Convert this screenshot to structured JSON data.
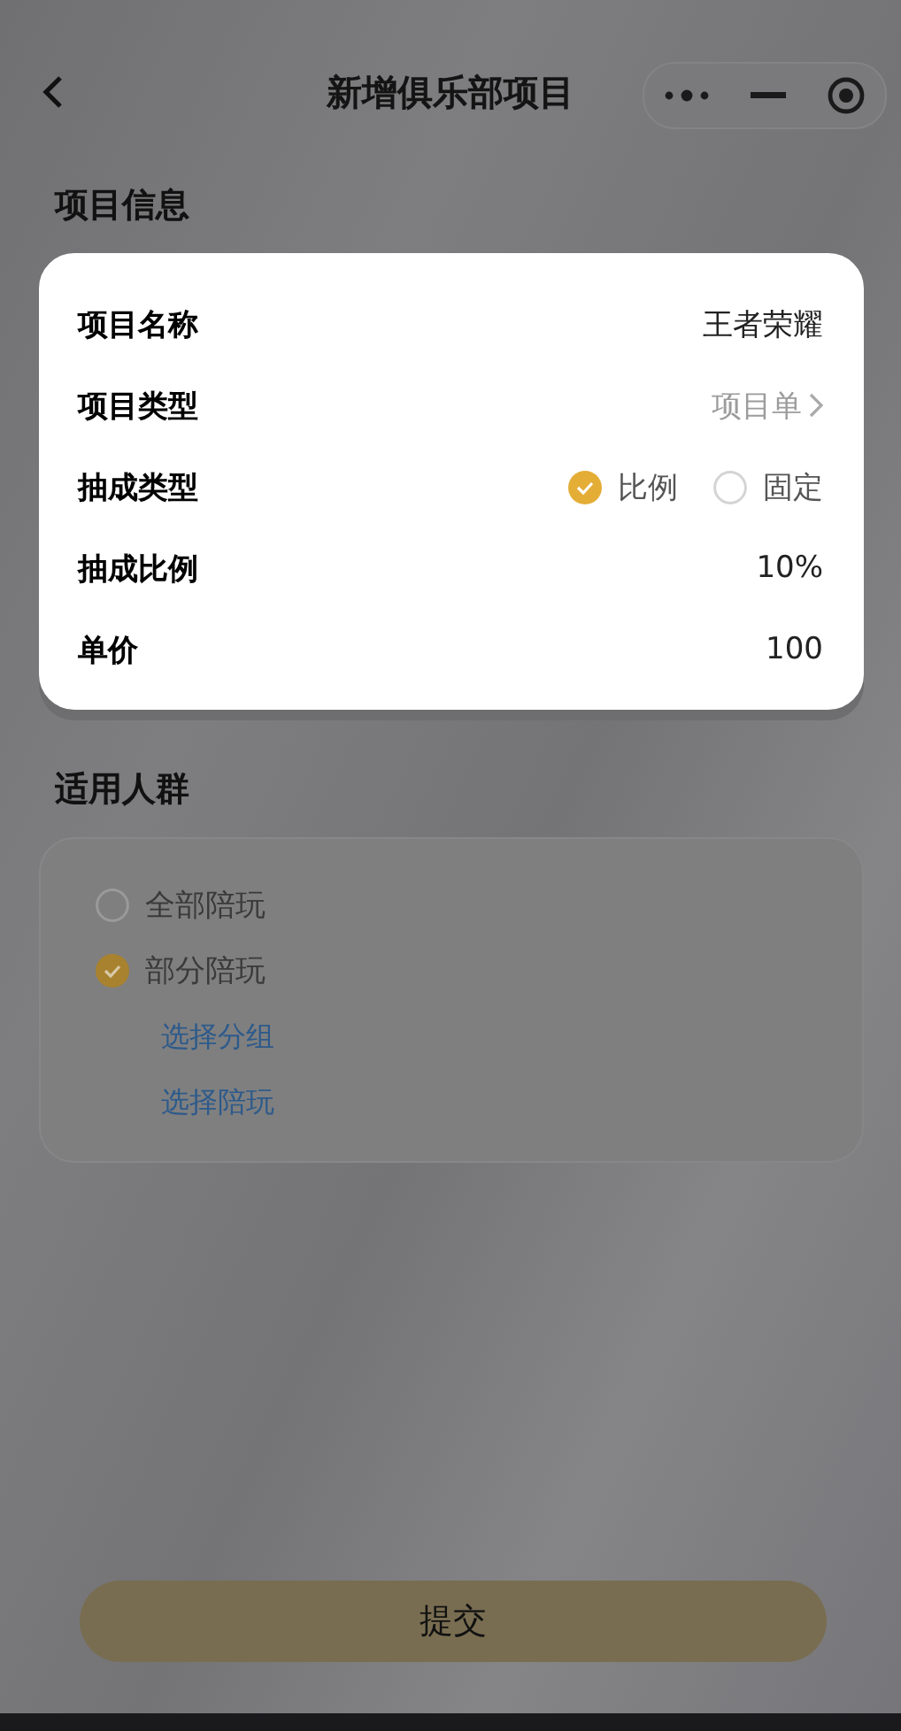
{
  "nav": {
    "title": "新增俱乐部项目"
  },
  "project_info": {
    "title": "项目信息",
    "highlighted": true,
    "rows": [
      {
        "kind": "text",
        "label": "项目名称",
        "value": "王者荣耀"
      },
      {
        "kind": "picker",
        "label": "项目类型",
        "value": "项目单"
      },
      {
        "kind": "radio",
        "label": "抽成类型",
        "options": [
          {
            "label": "比例",
            "selected": true
          },
          {
            "label": "固定",
            "selected": false
          }
        ]
      },
      {
        "kind": "text",
        "label": "抽成比例",
        "value": "10%"
      },
      {
        "kind": "text",
        "label": "单价",
        "value": "100"
      }
    ]
  },
  "audience": {
    "title": "适用人群",
    "highlighted": false,
    "options": [
      {
        "label": "全部陪玩",
        "selected": false
      },
      {
        "label": "部分陪玩",
        "selected": true
      }
    ],
    "links": [
      "选择分组",
      "选择陪玩"
    ]
  },
  "submit_button": "提交"
}
